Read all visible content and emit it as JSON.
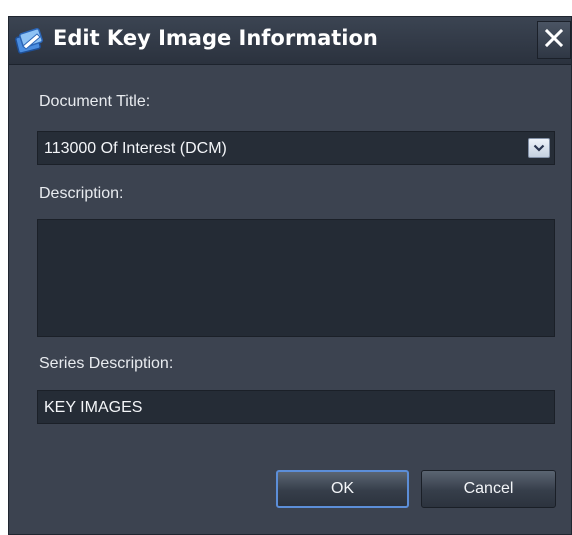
{
  "dialog": {
    "title": "Edit Key Image Information",
    "close_icon": "close-icon",
    "app_icon": "key-image-app-icon"
  },
  "fields": {
    "document_title_label": "Document Title:",
    "document_title_value": "113000 Of Interest (DCM)",
    "description_label": "Description:",
    "description_value": "",
    "series_description_label": "Series Description:",
    "series_description_value": "KEY IMAGES"
  },
  "buttons": {
    "ok_label": "OK",
    "cancel_label": "Cancel"
  },
  "colors": {
    "dialog_background": "#3c4350",
    "input_background": "#252c36",
    "default_button_focus": "#5c8ed8"
  }
}
